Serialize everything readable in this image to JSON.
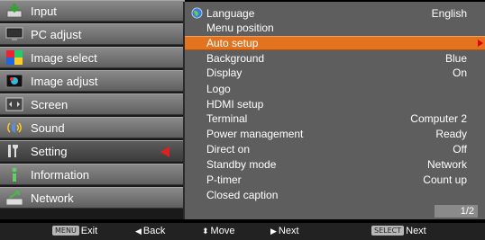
{
  "categories": [
    {
      "label": "Input",
      "icon": "input-icon"
    },
    {
      "label": "PC adjust",
      "icon": "pc-adjust-icon"
    },
    {
      "label": "Image select",
      "icon": "image-select-icon"
    },
    {
      "label": "Image adjust",
      "icon": "image-adjust-icon"
    },
    {
      "label": "Screen",
      "icon": "screen-icon"
    },
    {
      "label": "Sound",
      "icon": "sound-icon"
    },
    {
      "label": "Setting",
      "icon": "setting-icon"
    },
    {
      "label": "Information",
      "icon": "information-icon"
    },
    {
      "label": "Network",
      "icon": "network-icon"
    }
  ],
  "active_category": "Setting",
  "settings": [
    {
      "name": "Language",
      "value": "English"
    },
    {
      "name": "Menu position",
      "value": ""
    },
    {
      "name": "Auto setup",
      "value": ""
    },
    {
      "name": "Background",
      "value": "Blue"
    },
    {
      "name": "Display",
      "value": "On"
    },
    {
      "name": "Logo",
      "value": ""
    },
    {
      "name": "HDMI setup",
      "value": ""
    },
    {
      "name": "Terminal",
      "value": "Computer 2"
    },
    {
      "name": "Power management",
      "value": "Ready"
    },
    {
      "name": "Direct on",
      "value": "Off"
    },
    {
      "name": "Standby mode",
      "value": "Network"
    },
    {
      "name": "P-timer",
      "value": "Count up"
    },
    {
      "name": "Closed caption",
      "value": ""
    }
  ],
  "selected_setting": "Auto setup",
  "page_indicator": "1/2",
  "helpbar": {
    "exit_key": "MENU",
    "exit": "Exit",
    "back": "Back",
    "move": "Move",
    "next": "Next",
    "select_key": "SELECT",
    "select_next": "Next"
  },
  "colors": {
    "highlight": "#e3731e",
    "arrow": "#e02020",
    "panel": "#5e5e5e"
  }
}
